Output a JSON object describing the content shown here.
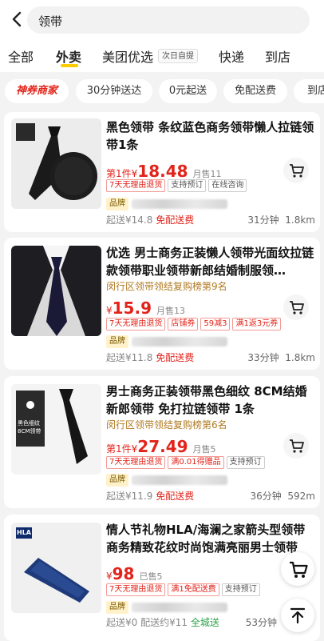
{
  "search": {
    "query": "领带"
  },
  "tabs": [
    {
      "label": "全部"
    },
    {
      "label": "外卖"
    },
    {
      "label": "美团优选"
    },
    {
      "label": "快递"
    },
    {
      "label": "到店"
    }
  ],
  "tab_badge": "次日自提",
  "filters": {
    "brand_chip": "神券商家",
    "chips": [
      "30分钟送达",
      "0元起送",
      "免配送费",
      "到店"
    ]
  },
  "products": [
    {
      "title": "黑色领带 条纹蓝色商务领带懒人拉链领带1条",
      "price_prefix": "第1件",
      "price_currency": "¥",
      "price": "18.48",
      "sales": "月售11",
      "tags": [
        "7天无理由退货",
        "支持预订",
        "在线咨询"
      ],
      "brand_label": "品牌",
      "min_order": "起送¥14.8",
      "fee": "免配送费",
      "time": "31分钟",
      "distance": "1.8km"
    },
    {
      "title": "优选 男士商务正装懒人领带光面纹拉链款领带职业领带新郎结婚制服领…",
      "rank": "闵行区领带领结复购榜第9名",
      "price_currency": "¥",
      "price": "15.9",
      "sales": "月售13",
      "tags": [
        "7天无理由退货",
        "店铺券",
        "59减3",
        "满1返3元券"
      ],
      "brand_label": "品牌",
      "min_order": "起送¥11.8",
      "fee": "免配送费",
      "time": "33分钟",
      "distance": "1.8km"
    },
    {
      "title": "男士商务正装领带黑色细纹 8CM结婚新郎领带 免打拉链领带 1条",
      "rank": "闵行区领带领结复购榜第6名",
      "price_prefix": "第1件",
      "price_currency": "¥",
      "price": "27.49",
      "sales": "月售5",
      "tags": [
        "7天无理由退货",
        "满0.01得赠品",
        "支持预订"
      ],
      "brand_label": "品牌",
      "min_order": "起送¥11.9",
      "fee": "免配送费",
      "time": "36分钟",
      "distance": "592m"
    },
    {
      "title": "情人节礼物HLA/海澜之家箭头型领带商务精致花纹时尚饱满亮丽男士领带",
      "price_currency": "¥",
      "price": "98",
      "sales": "已售5",
      "tags": [
        "7天无理由退货",
        "满1免配送费",
        "支持预订"
      ],
      "brand_label": "品牌",
      "min_order": "起送¥0",
      "fee": "配送约¥11",
      "extra": "全城送",
      "time": "53分钟"
    }
  ],
  "thumb_text": {
    "p3_line1": "黑色细纹",
    "p3_line2": "8CM领带",
    "p4_logo": "HLA"
  },
  "colors": {
    "price_red": "#e2231a",
    "tab_accent": "#ffcc00"
  }
}
